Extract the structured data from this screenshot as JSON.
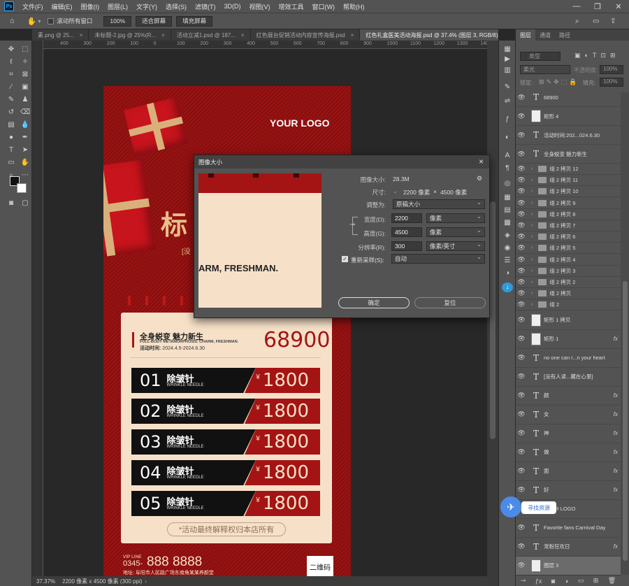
{
  "app": {
    "logo": "Ps"
  },
  "menu": [
    "文件(F)",
    "编辑(E)",
    "图像(I)",
    "图层(L)",
    "文字(Y)",
    "选择(S)",
    "滤镜(T)",
    "3D(D)",
    "视图(V)",
    "增效工具",
    "窗口(W)",
    "帮助(H)"
  ],
  "options": {
    "scroll_all": "滚动所有窗口",
    "zoom": "100%",
    "fit_screen": "适合屏幕",
    "fill_screen": "填充屏幕"
  },
  "tabs": [
    {
      "label": "素.png @ 25...",
      "active": false
    },
    {
      "label": "未标题-2.jpg @ 25%(R...",
      "active": false
    },
    {
      "label": "活动立减1.psd @ 187...",
      "active": false
    },
    {
      "label": "红色展台促销活动内容宣传海报.psd",
      "active": false
    },
    {
      "label": "红色礼盒医美活动海报.psd @ 37.4% (图层 3, RGB/8)",
      "active": true
    }
  ],
  "ruler": [
    "400",
    "300",
    "200",
    "100",
    "0",
    "100",
    "200",
    "300",
    "400",
    "500",
    "600",
    "700",
    "800",
    "900",
    "1000",
    "1100",
    "1200",
    "1300",
    "1400"
  ],
  "status": {
    "zoom": "37.37%",
    "size": "2200 像素 x 4500 像素 (300 ppi)"
  },
  "poster": {
    "logo": "YOUR LOGO",
    "title_cn": "全身蜕变 魅力新生",
    "title_en": "FULL-BODY METAMORPHOSIS. CHARM, FRESHMAN.",
    "date_label": "活动时间:",
    "date": "2024.4.5-2024.6.30",
    "big_price": "68900",
    "currency": "¥",
    "items": [
      {
        "num": "01",
        "cn": "除皱针",
        "en": "WRINKLE NEEDLE",
        "price": "1800"
      },
      {
        "num": "02",
        "cn": "除皱针",
        "en": "WRINKLE NEEDLE",
        "price": "1800"
      },
      {
        "num": "03",
        "cn": "除皱针",
        "en": "WRINKLE NEEDLE",
        "price": "1800"
      },
      {
        "num": "04",
        "cn": "除皱针",
        "en": "WRINKLE NEEDLE",
        "price": "1800"
      },
      {
        "num": "05",
        "cn": "除皱针",
        "en": "WRINKLE NEEDLE",
        "price": "1800"
      }
    ],
    "disclaimer": "*活动最终解释权归本店所有",
    "vip_label": "VIP LINE",
    "phone_prefix": "0345-",
    "phone": "888 8888",
    "address": "地址: 阜阳市人民路广场东南角某某养颜堂",
    "qr": "二维码",
    "partial_big": "标",
    "partial_sub": "[没"
  },
  "dialog": {
    "title": "图像大小",
    "image_size_label": "图像大小:",
    "image_size": "28.3M",
    "dims_label": "尺寸:",
    "dims_w": "2200 像素",
    "dims_x": "×",
    "dims_h": "4500 像素",
    "fit_label": "调整为:",
    "fit_value": "原稿大小",
    "width_label": "宽度(D):",
    "width": "2200",
    "width_unit": "像素",
    "height_label": "高度(G):",
    "height": "4500",
    "height_unit": "像素",
    "res_label": "分辨率(R):",
    "res": "300",
    "res_unit": "像素/英寸",
    "resample_label": "重新采样(S):",
    "resample": "自动",
    "ok": "确定",
    "reset": "复位",
    "preview_text": "ARM, FRESHMAN."
  },
  "panel": {
    "tabs": [
      "图层",
      "通道",
      "路径"
    ],
    "kind": "类型",
    "blend": "柔光",
    "opacity_label": "不透明度:",
    "opacity": "100%",
    "lock_label": "锁定:",
    "fill_label": "填充:",
    "fill": "100%",
    "layers": [
      {
        "type": "T",
        "name": "68900",
        "fx": false
      },
      {
        "type": "shape",
        "name": "矩形 4",
        "fx": false
      },
      {
        "type": "T",
        "name": "活动时间:202...024.6.30",
        "fx": false
      },
      {
        "type": "T",
        "name": "全身蜕变 魅力新生",
        "fx": false
      },
      {
        "type": "group",
        "name": "组 2 拷贝 12"
      },
      {
        "type": "group",
        "name": "组 2 拷贝 11"
      },
      {
        "type": "group",
        "name": "组 2 拷贝 10"
      },
      {
        "type": "group",
        "name": "组 2 拷贝 9"
      },
      {
        "type": "group",
        "name": "组 2 拷贝 8"
      },
      {
        "type": "group",
        "name": "组 2 拷贝 7"
      },
      {
        "type": "group",
        "name": "组 2 拷贝 6"
      },
      {
        "type": "group",
        "name": "组 2 拷贝 5"
      },
      {
        "type": "group",
        "name": "组 2 拷贝 4"
      },
      {
        "type": "group",
        "name": "组 2 拷贝 3"
      },
      {
        "type": "group",
        "name": "组 2 拷贝 2"
      },
      {
        "type": "group",
        "name": "组 2 拷贝"
      },
      {
        "type": "group",
        "name": "组 2"
      },
      {
        "type": "shape",
        "name": "矩形 1 拷贝",
        "fx": false
      },
      {
        "type": "shape",
        "name": "矩形 1",
        "fx": true
      },
      {
        "type": "T",
        "name": "no one can r...n your heart",
        "fx": false
      },
      {
        "type": "T",
        "name": "[没有人读...藏在心里]",
        "fx": false
      },
      {
        "type": "T",
        "name": "颜",
        "fx": true
      },
      {
        "type": "T",
        "name": "女",
        "fx": true
      },
      {
        "type": "T",
        "name": "神",
        "fx": true
      },
      {
        "type": "T",
        "name": "做",
        "fx": true
      },
      {
        "type": "T",
        "name": "面",
        "fx": true
      },
      {
        "type": "T",
        "name": "好",
        "fx": true
      },
      {
        "type": "T",
        "name": "YOUR LOGO",
        "fx": false
      },
      {
        "type": "T",
        "name": "Favorite fans Carnival Day",
        "fx": false
      },
      {
        "type": "T",
        "name": "宠粉狂欢日",
        "fx": true
      },
      {
        "type": "image",
        "name": "图层 3",
        "fx": false
      }
    ]
  },
  "find_resource": "寻找资源"
}
